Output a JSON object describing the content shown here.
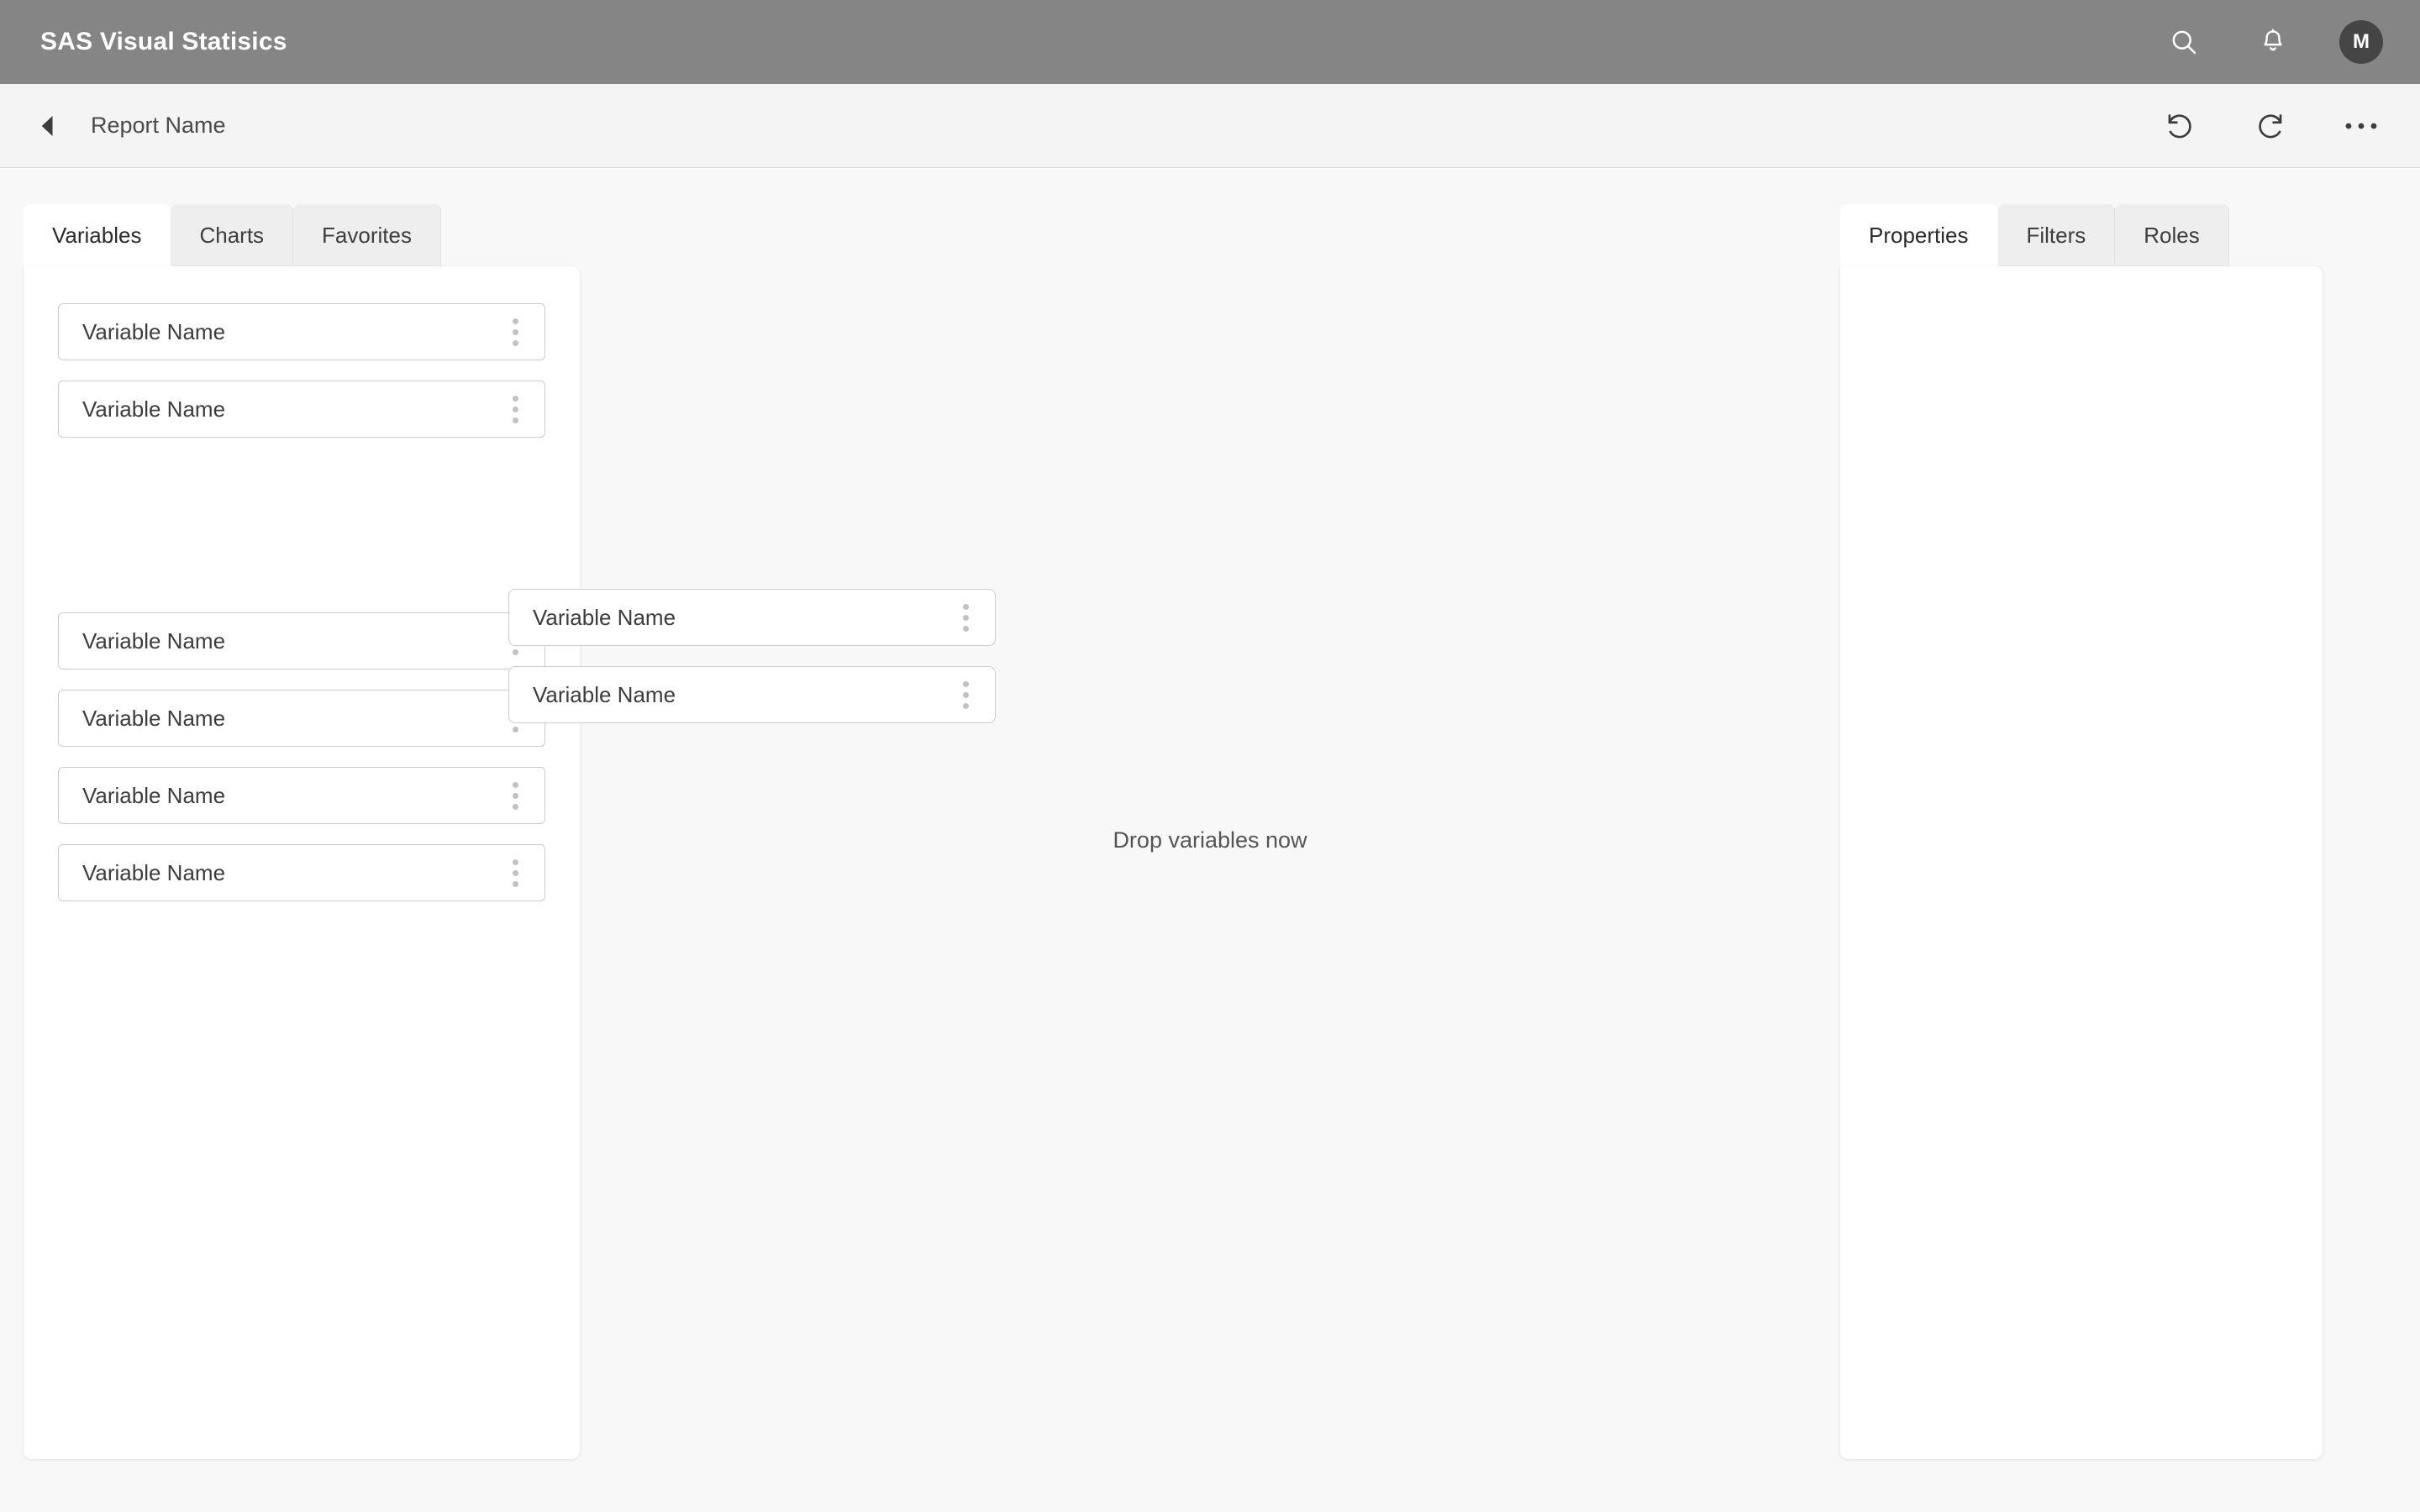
{
  "header": {
    "title": "SAS Visual Statisics",
    "search_icon": "search-icon",
    "notifications_icon": "bell-icon",
    "avatar_initial": "M",
    "background_color": "#858585",
    "avatar_color": "#454545"
  },
  "toolbar": {
    "back_icon": "back-arrow-icon",
    "report_name": "Report Name",
    "undo_icon": "undo-icon",
    "redo_icon": "redo-icon",
    "more_icon": "more-options-icon",
    "background_color": "#f4f4f4"
  },
  "left_panel": {
    "tabs": [
      {
        "label": "Variables",
        "active": true
      },
      {
        "label": "Charts",
        "active": false
      },
      {
        "label": "Favorites",
        "active": false
      }
    ],
    "cards": [
      {
        "label": "Variable Name",
        "menu_icon": "kebab-menu-icon"
      },
      {
        "label": "Variable Name",
        "menu_icon": "kebab-menu-icon"
      },
      {
        "label": "Variable Name",
        "menu_icon": "kebab-menu-icon"
      },
      {
        "label": "Variable Name",
        "menu_icon": "kebab-menu-icon"
      },
      {
        "label": "Variable Name",
        "menu_icon": "kebab-menu-icon"
      },
      {
        "label": "Variable Name",
        "menu_icon": "kebab-menu-icon"
      }
    ]
  },
  "floating_cards": [
    {
      "label": "Variable Name",
      "menu_icon": "kebab-menu-icon"
    },
    {
      "label": "Variable Name",
      "menu_icon": "kebab-menu-icon"
    }
  ],
  "canvas": {
    "drop_text": "Drop variables now",
    "background_color": "#f8f8f8"
  },
  "right_panel": {
    "tabs": [
      {
        "label": "Properties",
        "active": true
      },
      {
        "label": "Filters",
        "active": false
      },
      {
        "label": "Roles",
        "active": false
      }
    ]
  }
}
